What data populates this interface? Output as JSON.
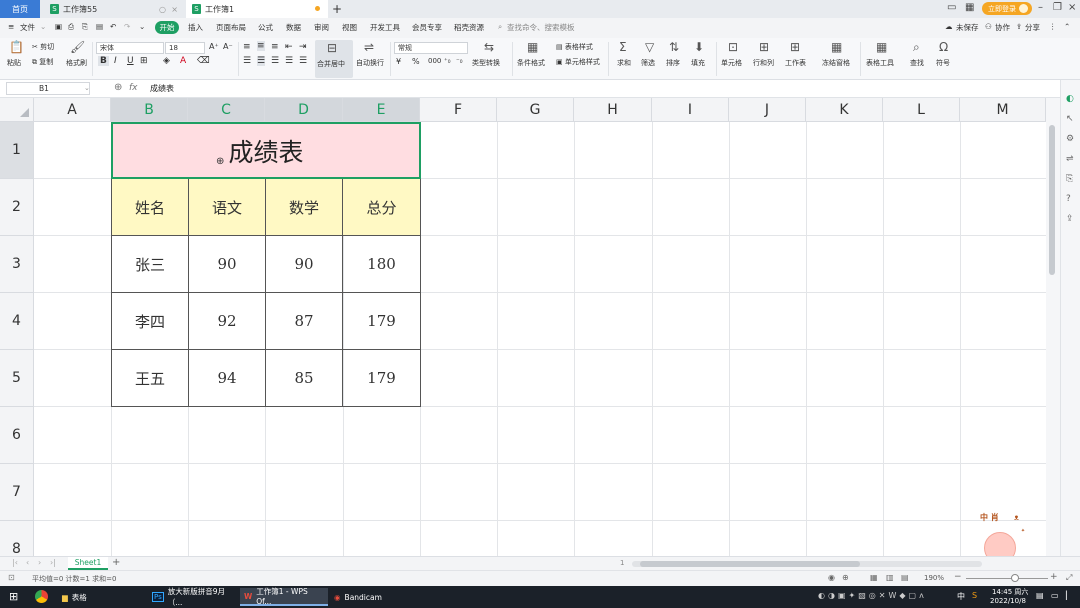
{
  "tabs": {
    "home": "首页",
    "doc1": "工作簿55",
    "doc2": "工作簿1",
    "login": "立即登录"
  },
  "menu": {
    "file": "文件",
    "start": "开始",
    "items": [
      "插入",
      "页面布局",
      "公式",
      "数据",
      "审阅",
      "视图",
      "开发工具",
      "会员专享",
      "稻壳资源"
    ],
    "search": "查找命令、搜索模板",
    "unsaved": "未保存",
    "collab": "协作",
    "share": "分享"
  },
  "ribbon": {
    "cut": "剪切",
    "paste": "粘贴",
    "copy": "复制",
    "format_painter": "格式刷",
    "font_name": "宋体",
    "font_size": "18",
    "merge": "合并居中",
    "wrap": "自动换行",
    "number_format": "常规",
    "type_convert": "类型转换",
    "cond_format": "条件格式",
    "table_style": "表格样式",
    "cell_style": "单元格样式",
    "sum": "求和",
    "filter": "筛选",
    "sort": "排序",
    "fill": "填充",
    "cell": "单元格",
    "rowcol": "行和列",
    "worksheet": "工作表",
    "freeze": "冻结窗格",
    "table_tools": "表格工具",
    "find": "查找",
    "symbol": "符号"
  },
  "formula_bar": {
    "cell_ref": "B1",
    "fx": "fx",
    "content": "成绩表"
  },
  "columns": [
    "A",
    "B",
    "C",
    "D",
    "E",
    "F",
    "G",
    "H",
    "I",
    "J",
    "K",
    "L",
    "M"
  ],
  "rows": [
    "1",
    "2",
    "3",
    "4",
    "5",
    "6",
    "7",
    "8"
  ],
  "table": {
    "title": "成绩表",
    "headers": [
      "姓名",
      "语文",
      "数学",
      "总分"
    ],
    "data": [
      [
        "张三",
        "90",
        "90",
        "180"
      ],
      [
        "李四",
        "92",
        "87",
        "179"
      ],
      [
        "王五",
        "94",
        "85",
        "179"
      ]
    ]
  },
  "sheet": {
    "name": "Sheet1",
    "page": "1"
  },
  "status": {
    "stats": "平均值=0  计数=1  求和=0",
    "zoom": "190%"
  },
  "taskbar": {
    "apps": [
      "表格",
      "放大新版拼音9月（...",
      "工作簿1 - WPS Of...",
      "Bandicam"
    ],
    "time": "14:45 周六",
    "date": "2022/10/8",
    "lang": "中"
  },
  "watermark": {
    "text": "中 肖"
  },
  "colors": {
    "accent": "#1e9f63",
    "title_fill": "#ffdde1",
    "header_fill": "#fff9c4"
  }
}
